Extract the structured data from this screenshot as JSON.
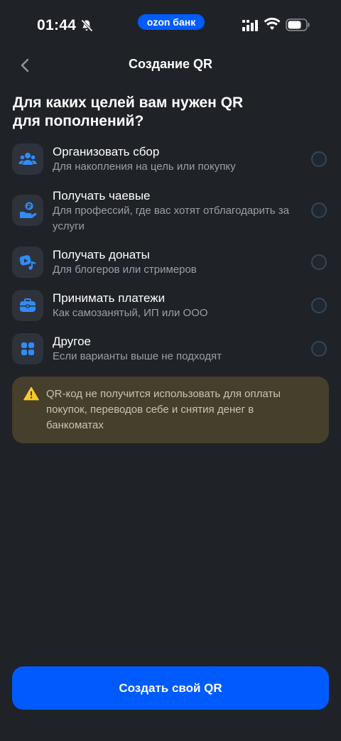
{
  "status_bar": {
    "time": "01:44",
    "brand": "ozon банк",
    "icons": [
      "bell-off-icon",
      "signal-icon",
      "wifi-icon",
      "battery-icon"
    ]
  },
  "nav": {
    "back_icon": "chevron-left-icon",
    "title": "Создание QR"
  },
  "heading_line1": "Для каких целей вам нужен QR",
  "heading_line2": "для пополнений?",
  "options": [
    {
      "icon": "people-icon",
      "title": "Организовать сбор",
      "description": "Для накопления на цель или покупку",
      "selected": false
    },
    {
      "icon": "hand-coin-icon",
      "title": "Получать чаевые",
      "description": "Для профессий, где вас хотят отблагодарить за услуги",
      "selected": false
    },
    {
      "icon": "video-music-icon",
      "title": "Получать донаты",
      "description": "Для блогеров или стримеров",
      "selected": false
    },
    {
      "icon": "briefcase-icon",
      "title": "Принимать платежи",
      "description": "Как самозанятый, ИП или ООО",
      "selected": false
    },
    {
      "icon": "grid-icon",
      "title": "Другое",
      "description": "Если варианты выше не подходят",
      "selected": false
    }
  ],
  "warning": {
    "icon": "warning-icon",
    "text": "QR-код не получится использовать для оплаты покупок, переводов себе и снятия денег в банкоматах"
  },
  "create_button_label": "Создать свой QR",
  "colors": {
    "background": "#1f2227",
    "accent": "#005bff",
    "icon_blue": "#2f8cff",
    "warning_bg": "#453f2c",
    "warning_icon": "#f7c92c"
  }
}
